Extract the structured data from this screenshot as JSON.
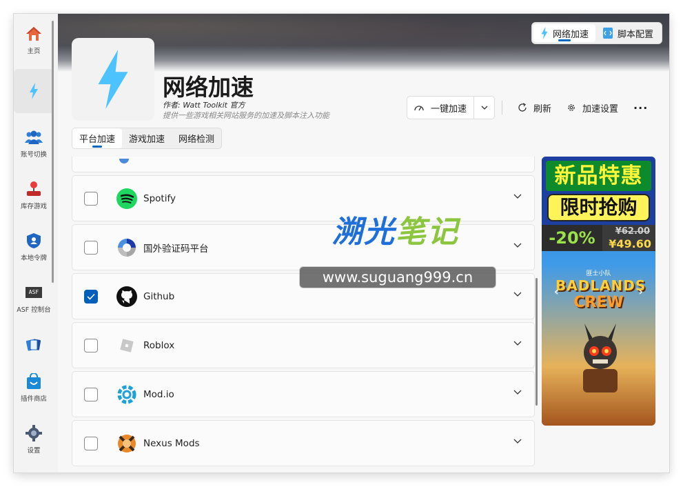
{
  "sidebar": {
    "items": [
      {
        "label": "主页",
        "icon": "home-icon"
      },
      {
        "label": "",
        "icon": "lightning-icon"
      },
      {
        "label": "账号切换",
        "icon": "users-icon"
      },
      {
        "label": "库存游戏",
        "icon": "joystick-icon"
      },
      {
        "label": "本地令牌",
        "icon": "shield-icon"
      },
      {
        "label": "ASF 控制台",
        "icon": "asf-icon"
      },
      {
        "label": "",
        "icon": "cards-icon"
      },
      {
        "label": "插件商店",
        "icon": "store-bag-icon"
      },
      {
        "label": "设置",
        "icon": "gear-icon"
      }
    ],
    "asf_badge": "ASF"
  },
  "top_tabs": [
    {
      "label": "网络加速",
      "icon": "lightning-icon"
    },
    {
      "label": "脚本配置",
      "icon": "script-icon"
    }
  ],
  "header": {
    "title": "网络加速",
    "author": "作者:  Watt Toolkit  官方",
    "description": "提供一些游戏相关网站服务的加速及脚本注入功能"
  },
  "toolbar": {
    "accelerate_label": "一键加速",
    "refresh_label": "刷新",
    "settings_label": "加速设置",
    "more_label": "···"
  },
  "sub_tabs": [
    "平台加速",
    "游戏加速",
    "网络检测"
  ],
  "list": [
    {
      "name": "Spotify",
      "checked": false,
      "icon": "spotify-icon"
    },
    {
      "name": "国外验证码平台",
      "checked": false,
      "icon": "recaptcha-icon"
    },
    {
      "name": "Github",
      "checked": true,
      "icon": "github-icon"
    },
    {
      "name": "Roblox",
      "checked": false,
      "icon": "roblox-icon"
    },
    {
      "name": "Mod.io",
      "checked": false,
      "icon": "modio-icon"
    },
    {
      "name": "Nexus Mods",
      "checked": false,
      "icon": "nexus-icon"
    }
  ],
  "ad": {
    "line1": "新品特惠",
    "line2": "限时抢购",
    "discount": "-20%",
    "old_price": "¥62.00",
    "new_price": "¥49.60",
    "game_title_cn": "匪士小队",
    "game_title_1": "BADLANDS",
    "game_title_2": "CREW"
  },
  "watermark": {
    "title_part1": "溯光",
    "title_part2": "笔记",
    "url": "www.suguang999.cn"
  },
  "colors": {
    "accent": "#005fb8",
    "lightning": "#4cc2ff"
  }
}
